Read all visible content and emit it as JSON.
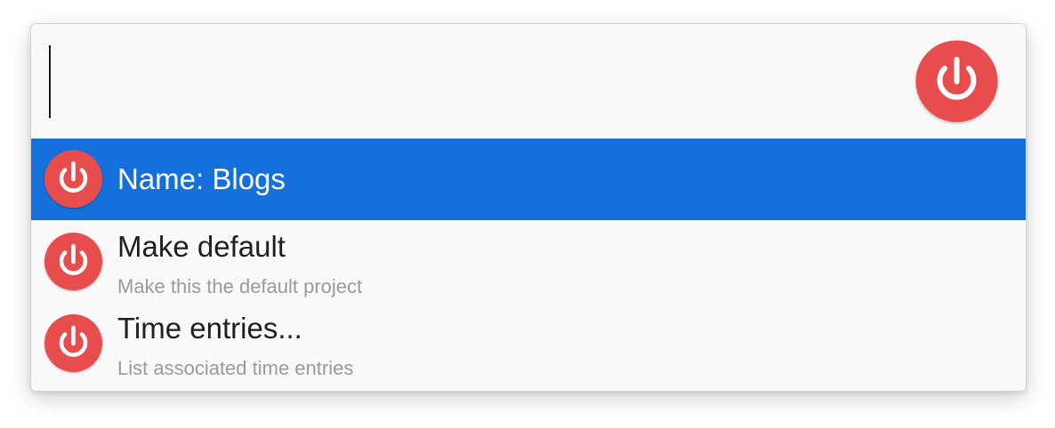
{
  "launcher": {
    "query": "",
    "app_icon": "power-icon",
    "icon_color": "#e84d4d",
    "selection_color": "#1570dc"
  },
  "results": [
    {
      "title": "Name: Blogs",
      "subtitle": "",
      "icon": "power-icon",
      "selected": true
    },
    {
      "title": "Make default",
      "subtitle": "Make this the default project",
      "icon": "power-icon",
      "selected": false
    },
    {
      "title": "Time entries...",
      "subtitle": "List associated time entries",
      "icon": "power-icon",
      "selected": false
    }
  ]
}
